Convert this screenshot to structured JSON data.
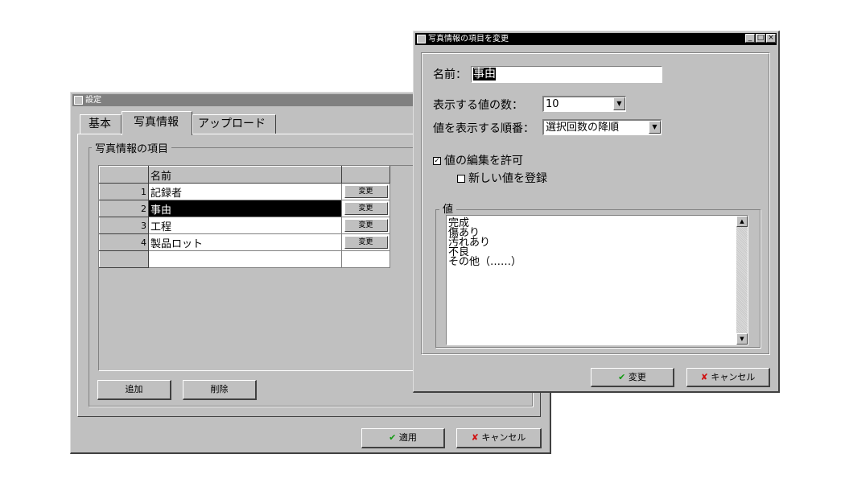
{
  "settings_window": {
    "title": "設定",
    "tabs": [
      "基本",
      "写真情報",
      "アップロード"
    ],
    "group_label": "写真情報の項目",
    "grid_header": "名前",
    "rows": [
      {
        "num": "1",
        "name": "記録者",
        "button": "変更"
      },
      {
        "num": "2",
        "name": "事由",
        "button": "変更"
      },
      {
        "num": "3",
        "name": "工程",
        "button": "変更"
      },
      {
        "num": "4",
        "name": "製品ロット",
        "button": "変更"
      }
    ],
    "add_button": "追加",
    "delete_button": "削除",
    "apply_button": "適用",
    "cancel_button": "キャンセル"
  },
  "edit_dialog": {
    "title": "写真情報の項目を変更",
    "name_label": "名前：",
    "name_value": "事由",
    "count_label": "表示する値の数：",
    "count_value": "10",
    "order_label": "値を表示する順番：",
    "order_value": "選択回数の降順",
    "allow_edit_label": "値の編集を許可",
    "allow_edit_checked": "✓",
    "register_new_label": "新しい値を登録",
    "values_group_label": "値",
    "values": [
      "完成",
      "傷あり",
      "汚れあり",
      "不良",
      "その他（……）"
    ],
    "ok_button": "変更",
    "cancel_button": "キャンセル"
  },
  "icons": {
    "check": "✔",
    "cross": "✘"
  },
  "colors": {
    "window_face": "#c0c0c0",
    "active_title": "#000000",
    "inactive_title": "#808080",
    "ok_green": "#119a11",
    "cancel_red": "#d01010"
  }
}
